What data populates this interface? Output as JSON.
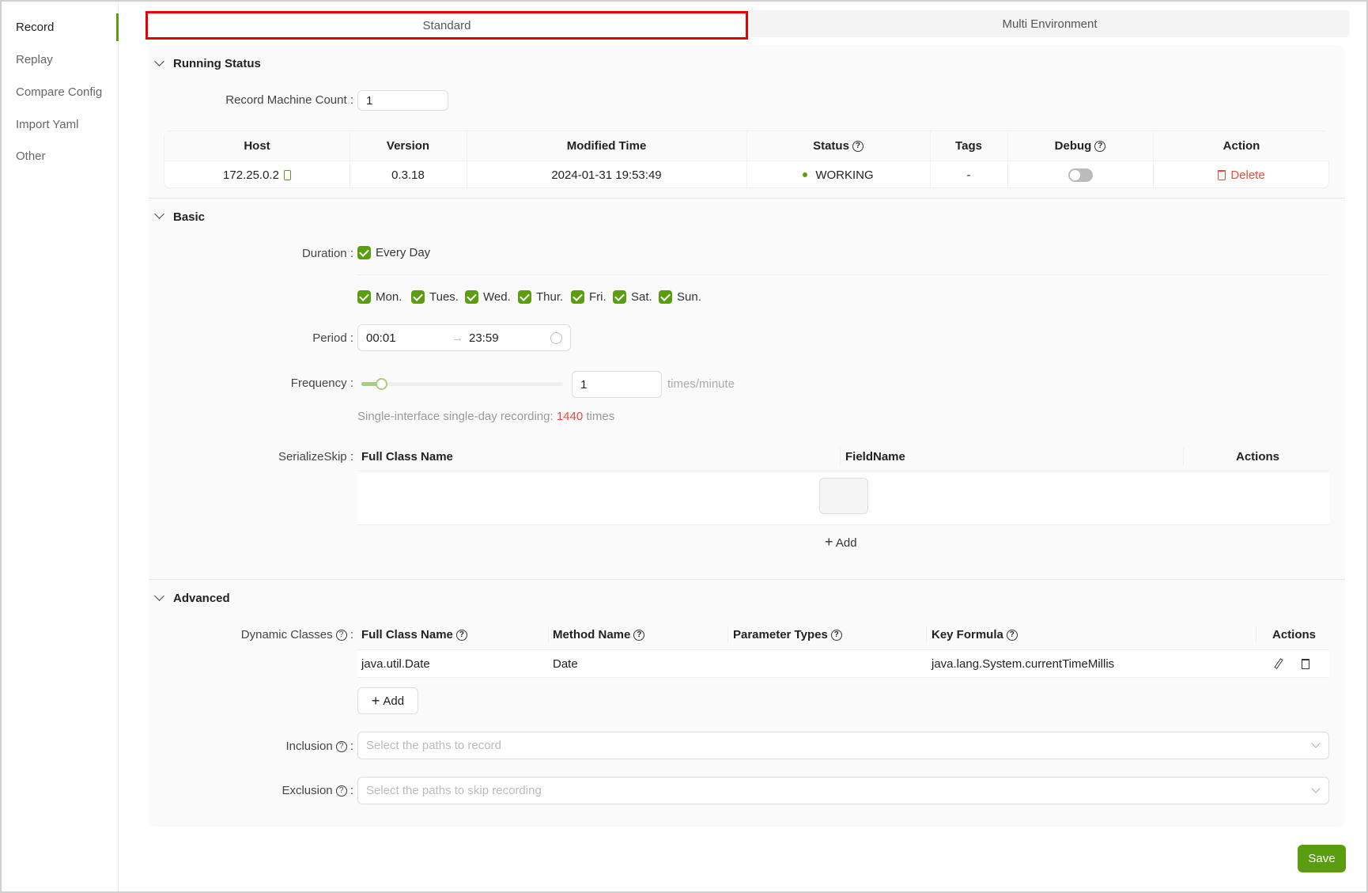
{
  "colors": {
    "accent": "#5a9e0f",
    "danger": "#f5483b",
    "highlight": "#e60000"
  },
  "sidebar": {
    "items": [
      {
        "label": "Record",
        "active": true
      },
      {
        "label": "Replay"
      },
      {
        "label": "Compare Config"
      },
      {
        "label": "Import Yaml"
      },
      {
        "label": "Other"
      }
    ]
  },
  "tabs": [
    {
      "label": "Standard",
      "active": true
    },
    {
      "label": "Multi Environment"
    }
  ],
  "running": {
    "title": "Running Status",
    "machine_count_label": "Record Machine Count",
    "machine_count": "1",
    "columns": [
      "Host",
      "Version",
      "Modified Time",
      "Status",
      "Tags",
      "Debug",
      "Action"
    ],
    "row": {
      "host": "172.25.0.2",
      "version": "0.3.18",
      "modified": "2024-01-31 19:53:49",
      "status": "WORKING",
      "tags": "-",
      "debug": false,
      "action": "Delete"
    }
  },
  "basic": {
    "title": "Basic",
    "duration_label": "Duration",
    "every_day": "Every Day",
    "days": [
      "Mon.",
      "Tues.",
      "Wed.",
      "Thur.",
      "Fri.",
      "Sat.",
      "Sun."
    ],
    "period_label": "Period",
    "period_start": "00:01",
    "period_end": "23:59",
    "frequency_label": "Frequency",
    "frequency": "1",
    "frequency_unit": "times/minute",
    "hint_prefix": "Single-interface single-day recording:",
    "hint_count": "1440",
    "hint_suffix": "times",
    "serialize_label": "SerializeSkip",
    "serialize_columns": [
      "Full Class Name",
      "FieldName",
      "Actions"
    ],
    "add_label": "Add"
  },
  "advanced": {
    "title": "Advanced",
    "dynamic_label": "Dynamic Classes",
    "columns": [
      "Full Class Name",
      "Method Name",
      "Parameter Types",
      "Key Formula",
      "Actions"
    ],
    "row": {
      "class": "java.util.Date",
      "method": "Date",
      "params": "",
      "formula": "java.lang.System.currentTimeMillis"
    },
    "add_label": "Add",
    "inclusion_label": "Inclusion",
    "inclusion_placeholder": "Select the paths to record",
    "exclusion_label": "Exclusion",
    "exclusion_placeholder": "Select the paths to skip recording"
  },
  "save_label": "Save"
}
